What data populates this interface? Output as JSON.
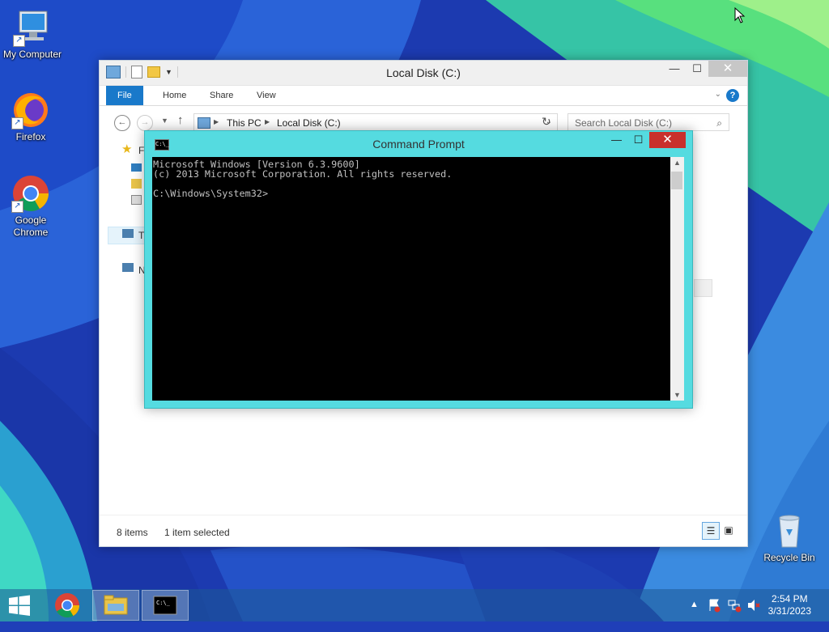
{
  "desktop": {
    "icons": [
      {
        "label": "My Computer"
      },
      {
        "label": "Firefox"
      },
      {
        "label": "Google Chrome"
      },
      {
        "label": "Recycle Bin"
      }
    ]
  },
  "explorer": {
    "title": "Local Disk (C:)",
    "ribbon_tabs": [
      "File",
      "Home",
      "Share",
      "View"
    ],
    "breadcrumb": [
      "This PC",
      "Local Disk (C:)"
    ],
    "search_placeholder": "Search Local Disk (C:)",
    "nav_truncated": [
      "F",
      "T",
      "N"
    ],
    "status": {
      "items": "8 items",
      "selected": "1 item selected"
    }
  },
  "cmd": {
    "title": "Command Prompt",
    "icon_text": "C:\\_",
    "lines": [
      "Microsoft Windows [Version 6.3.9600]",
      "(c) 2013 Microsoft Corporation. All rights reserved.",
      "",
      "C:\\Windows\\System32>"
    ]
  },
  "taskbar": {
    "time": "2:54 PM",
    "date": "3/31/2023"
  },
  "colors": {
    "cmd_frame": "#55dbe0",
    "file_tab": "#1979ca",
    "close_active": "#c9302c"
  }
}
